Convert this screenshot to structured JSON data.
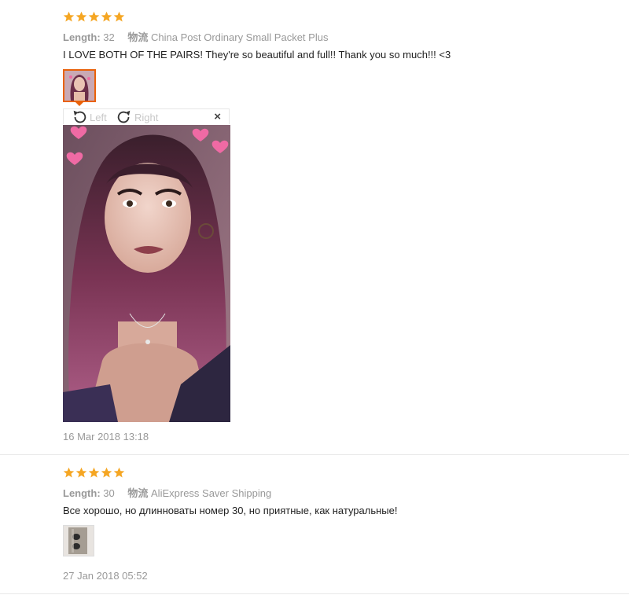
{
  "reviews": [
    {
      "rating": 5,
      "length_label": "Length:",
      "length_value": "32",
      "ship_label": "物流",
      "ship_value": "China Post Ordinary Small Packet Plus",
      "text": "I LOVE BOTH OF THE PAIRS! They're so beautiful and full!! Thank you so much!!! <3",
      "viewer": {
        "rotate_left": "Left",
        "rotate_right": "Right",
        "close": "×"
      },
      "date": "16 Mar 2018 13:18"
    },
    {
      "rating": 5,
      "length_label": "Length:",
      "length_value": "30",
      "ship_label": "物流",
      "ship_value": "AliExpress Saver Shipping",
      "text": "Все хорошо, но длинноваты номер 30, но приятные, как натуральные!",
      "date": "27 Jan 2018 05:52"
    }
  ],
  "colors": {
    "star": "#f5a623",
    "accent": "#e9620a",
    "meta": "#999999"
  }
}
